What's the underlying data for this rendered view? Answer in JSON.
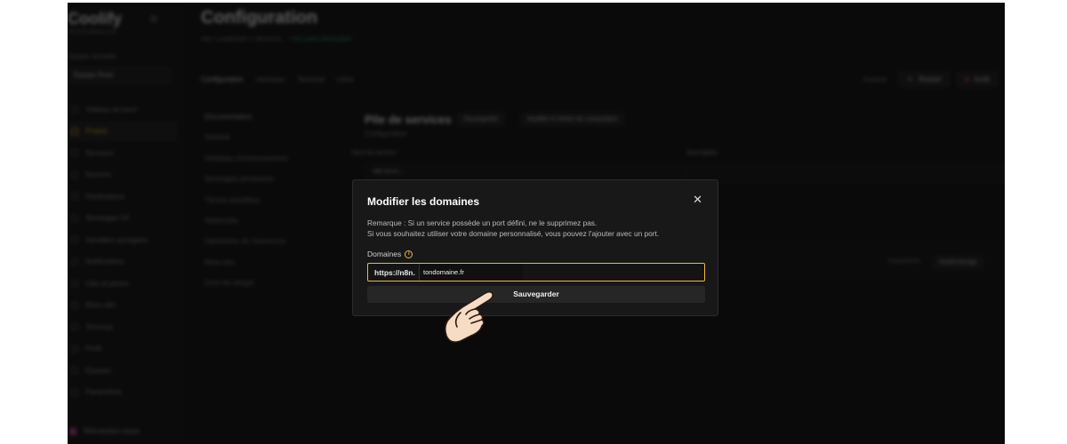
{
  "app": {
    "logo": "Coolify",
    "logo_sub": "v4.0.0-beta.xxx",
    "team_label": "Équipe actuelle",
    "team_value": "Équipe Root"
  },
  "sidebar": {
    "items": [
      {
        "label": "Tableau de bord",
        "icon": "home-icon"
      },
      {
        "label": "Projets",
        "icon": "layers-icon",
        "active": true
      },
      {
        "label": "Serveurs",
        "icon": "server-icon"
      },
      {
        "label": "Sources",
        "icon": "git-icon"
      },
      {
        "label": "Destinations",
        "icon": "network-icon"
      },
      {
        "label": "Stockages S3",
        "icon": "storage-icon"
      },
      {
        "label": "Variables partagées",
        "icon": "variables-icon"
      },
      {
        "label": "Notifications",
        "icon": "bell-icon"
      },
      {
        "label": "Clés et jetons",
        "icon": "key-icon"
      },
      {
        "label": "Mots-clés",
        "icon": "tag-icon"
      },
      {
        "label": "Terminal",
        "icon": "terminal-icon"
      },
      {
        "label": "Profil",
        "icon": "user-icon"
      },
      {
        "label": "Équipes",
        "icon": "users-icon"
      },
      {
        "label": "Paramètres",
        "icon": "settings-icon"
      }
    ],
    "feedback": "Rétroaction reçue"
  },
  "header": {
    "title": "Configuration",
    "breadcrumb": [
      "n8n",
      "production",
      "n8n-hrcm…"
    ],
    "status": "En cours d'exécution",
    "tabs": [
      "Configuration",
      "Journaux",
      "Terminal",
      "Liens"
    ],
    "actions": {
      "advanced": "Avancé",
      "restart": "Restart",
      "stop": "Arrêt"
    }
  },
  "subnav": [
    "Documentation",
    "Général",
    "Variables d'environnement",
    "Stockages persistants",
    "Tâches planifiées",
    "Webhooks",
    "Opérations de ressources",
    "Mots-clés",
    "Zone de danger"
  ],
  "stack": {
    "title": "Pile de services",
    "save": "Sauvegarder",
    "edit_compose": "Modifier le fichier de composition",
    "subtitle": "Configuration",
    "name_label": "Nom du service",
    "name_value": "n8n-hrcm…",
    "description_label": "Description",
    "settings": "Paramètres",
    "redeploy": "Redémarrage"
  },
  "modal": {
    "title": "Modifier les domaines",
    "note_line1": "Remarque : Si un service possède un port défini, ne le supprimez pas.",
    "note_line2": "Si vous souhaitez utiliser votre domaine personnalisé, vous pouvez l'ajouter avec un port.",
    "domains_label": "Domaines",
    "domain_prefix": "https://n8n.",
    "domain_value": "tondomaine.fr",
    "save_label": "Sauvegarder",
    "close_icon": "close-icon",
    "info_icon": "info-icon"
  },
  "colors": {
    "accent": "#e9b949",
    "danger": "#e24c4c",
    "success": "#2fbf71",
    "modal_bg": "#181818",
    "app_bg": "#101010"
  }
}
